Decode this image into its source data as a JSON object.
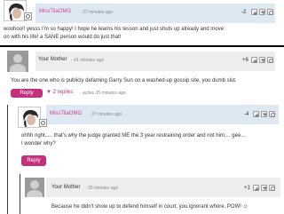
{
  "comment1": {
    "author": "MissTilaOMG",
    "time": "· 37 minutes ago",
    "score": "-2",
    "text_line1": "woohoo!! yesss I'm so happy! I hope he learns his lesson and just shuts up already and move",
    "text_line2": "on with his life! a SANE person would do just that!"
  },
  "comment2": {
    "author": "Your Mother",
    "time": "· 41 minutes ago",
    "score": "+6",
    "text": "You are the one who is publicly defaming Garry Sun on a washed-up gossip site, you dumb slut.",
    "reply_label": "Reply",
    "replies_link": "▼ 2 replies",
    "active": "· active 35 minutes ago"
  },
  "comment3": {
    "author": "MissTilaOMG",
    "time": "· 37 minutes ago",
    "score": "-4",
    "text_line1": "ohhh right..... that's why the judge granted ME the 3 year restraining order and not him.... gee...",
    "text_line2": "I wonder why?",
    "reply_label": "Reply"
  },
  "comment4": {
    "author": "Your Mother",
    "time": "· 35 minutes ago",
    "score": "+1",
    "text": "Because he didn't show up to defend himself in court, you ignorant whore. POW! ☺"
  },
  "colors": {
    "accent_pink": "#c3307c",
    "name_pink": "#d33f8f",
    "header_blue": "#dde8f3",
    "header_gray": "#ededed"
  },
  "icons": [
    "thumbs-up-icon",
    "thumbs-down-icon",
    "flag-icon"
  ]
}
